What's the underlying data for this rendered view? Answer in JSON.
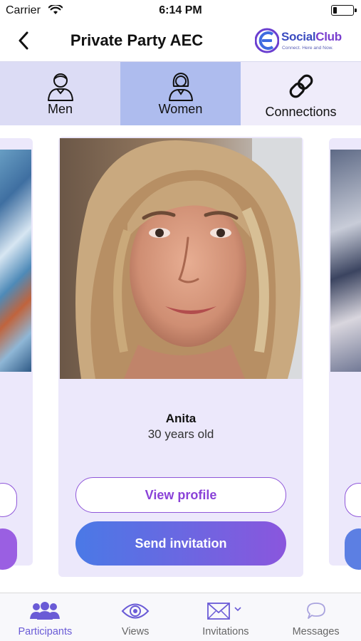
{
  "status_bar": {
    "carrier": "Carrier",
    "time": "6:14 PM",
    "battery_level": 0.2
  },
  "nav": {
    "title": "Private Party AEC",
    "logo": {
      "name_part1": "Social",
      "name_part2": "Club",
      "tagline": "Connect. Here and Now."
    }
  },
  "tabs": {
    "men": "Men",
    "women": "Women",
    "connections": "Connections",
    "selected": "women"
  },
  "profile": {
    "name": "Anita",
    "age": "30 years old",
    "view_profile": "View profile",
    "send_invitation": "Send invitation"
  },
  "tabbar": {
    "participants": "Participants",
    "views": "Views",
    "invitations": "Invitations",
    "messages": "Messages",
    "active": "participants"
  },
  "colors": {
    "accent": "#8a42d8",
    "gradient_start": "#4a79e6",
    "gradient_end": "#8a56dd",
    "active_tab": "#6a5bd6",
    "women_tab_bg": "#aebcee"
  }
}
